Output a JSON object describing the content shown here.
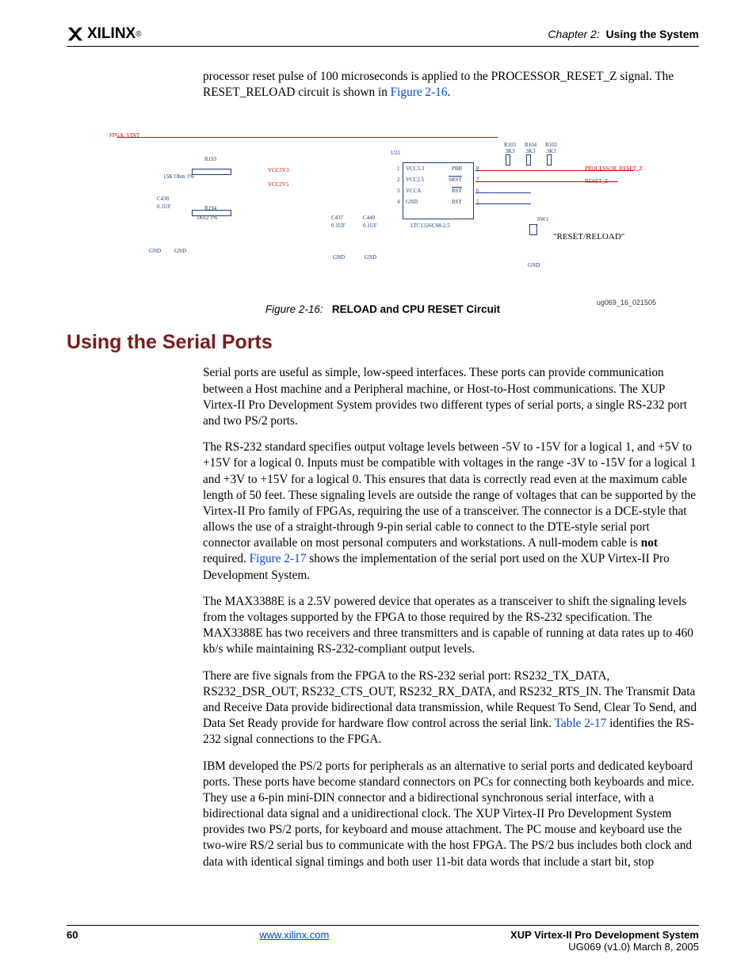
{
  "header": {
    "logo_text": "XILINX",
    "logo_reg": "®",
    "chapter_prefix": "Chapter 2:",
    "chapter_title": "Using the System"
  },
  "intro_para": {
    "part1": "processor reset pulse of 100 microseconds is applied to the PROCESSOR_RESET_Z signal. The RESET_RELOAD circuit is shown in ",
    "xref": "Figure 2-16",
    "part2": "."
  },
  "figure": {
    "id_label": "ug069_16_021505",
    "caption_prefix": "Figure 2-16:",
    "caption_title": "RELOAD and CPU RESET Circuit",
    "labels": {
      "fpga_vint": "FPGA_VINT",
      "vcc3v3": "VCC3V3",
      "vcc2v5": "VCC2V5",
      "r193": "R193",
      "r193v": "15K Ohm 1%",
      "r194": "R194",
      "r194v": "1K62 1%",
      "c438": "C438",
      "c438v": "0.1UF",
      "c437": "C437",
      "c437v": "0.1UF",
      "c440": "C440",
      "c440v": "0.1UF",
      "gnd": "GND",
      "u22": "U22",
      "vcc33": "VCC3.3",
      "vcc25": "VCC2.5",
      "vcca": "VCCA",
      "pbr": "PBR",
      "srst": "SRST",
      "rst": "RST",
      "rst2": "RST",
      "part": "LTC1326CS8-2.5",
      "r103": "R103\n3K3",
      "r104": "R104\n3K3",
      "r102": "R102\n3K3",
      "proc_reset": "PROCESSOR_RESET_Z",
      "reset_z": "RESET_Z",
      "sw1": "SW1",
      "reset_reload": "\"RESET/RELOAD\"",
      "p1": "1",
      "p2": "2",
      "p3": "3",
      "p4": "4",
      "p5": "5",
      "p6": "6",
      "p7": "7",
      "p8": "8"
    }
  },
  "section_heading": "Using the Serial Ports",
  "paragraphs": {
    "p1": "Serial ports are useful as simple, low-speed interfaces. These ports can provide communication between a Host machine and a Peripheral machine, or Host-to-Host communications. The XUP Virtex-II Pro Development System provides two different types of serial ports, a single RS-232 port and two PS/2 ports.",
    "p2_a": "The RS-232 standard specifies output voltage levels between -5V to -15V for a logical 1, and +5V to +15V for a logical 0. Inputs must be compatible with voltages in the range -3V to -15V for a logical 1 and +3V to +15V for a logical 0. This ensures that data is correctly read even at the maximum cable length of 50 feet. These signaling levels are outside the range of voltages that can be supported by the Virtex-II Pro family of FPGAs, requiring the use of a transceiver. The connector is a DCE-style that allows the use of a straight-through 9-pin serial cable to connect to the DTE-style serial port connector available on most personal computers and workstations. A null-modem cable is ",
    "p2_bold": "not",
    "p2_b": " required. ",
    "p2_xref": "Figure 2-17",
    "p2_c": " shows the implementation of the serial port used on the XUP Virtex-II Pro Development System.",
    "p3": "The MAX3388E is a 2.5V powered device that operates as a transceiver to shift the signaling levels from the voltages supported by the FPGA to those required by the RS-232 specification. The MAX3388E has two receivers and three transmitters and is capable of running at data rates up to 460 kb/s while maintaining RS-232-compliant output levels.",
    "p4_a": "There are five signals from the FPGA to the RS-232 serial port: RS232_TX_DATA, RS232_DSR_OUT, RS232_CTS_OUT, RS232_RX_DATA, and RS232_RTS_IN. The Transmit Data and Receive Data provide bidirectional data transmission, while Request To Send, Clear To Send, and Data Set Ready provide for hardware flow control across the serial link. ",
    "p4_xref": "Table 2-17",
    "p4_b": " identifies the RS-232 signal connections to the FPGA.",
    "p5": "IBM developed the PS/2 ports for peripherals as an alternative to serial ports and dedicated keyboard ports. These ports have become standard connectors on PCs for connecting both keyboards and mice. They use a 6-pin mini-DIN connector and a bidirectional synchronous serial interface, with a bidirectional data signal and a unidirectional clock. The XUP Virtex-II Pro Development System provides two PS/2 ports, for keyboard and mouse attachment. The PC mouse and keyboard use the two-wire RS/2 serial bus to communicate with the host FPGA. The PS/2 bus includes both clock and data with identical signal timings and both user 11-bit data words that include a start bit, stop"
  },
  "footer": {
    "page_number": "60",
    "url": "www.xilinx.com",
    "doc_title": "XUP  Virtex-II Pro Development System",
    "doc_rev": "UG069 (v1.0) March 8, 2005"
  }
}
